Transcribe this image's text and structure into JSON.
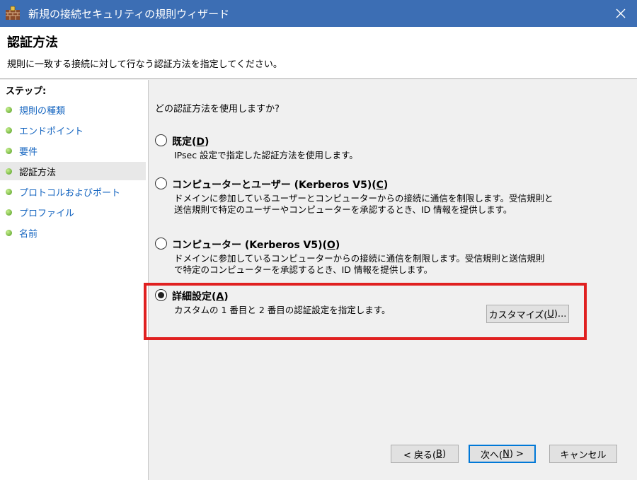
{
  "window": {
    "title": "新規の接続セキュリティの規則ウィザード",
    "close_glyph": "✕"
  },
  "header": {
    "title": "認証方法",
    "description": "規則に一致する接続に対して行なう認証方法を指定してください。"
  },
  "steps": {
    "title": "ステップ:",
    "items": [
      {
        "label": "規則の種類",
        "active": false
      },
      {
        "label": "エンドポイント",
        "active": false
      },
      {
        "label": "要件",
        "active": false
      },
      {
        "label": "認証方法",
        "active": true
      },
      {
        "label": "プロトコルおよびポート",
        "active": false
      },
      {
        "label": "プロファイル",
        "active": false
      },
      {
        "label": "名前",
        "active": false
      }
    ]
  },
  "main": {
    "question": "どの認証方法を使用しますか?",
    "options": [
      {
        "label_pre": "既定(",
        "label_key": "D",
        "label_post": ")",
        "desc": [
          "IPsec 設定で指定した認証方法を使用します。"
        ],
        "checked": false
      },
      {
        "label_pre": "コンピューターとユーザー (Kerberos V5)(",
        "label_key": "C",
        "label_post": ")",
        "desc": [
          "ドメインに参加しているユーザーとコンピューターからの接続に通信を制限します。受信規則と",
          "送信規則で特定のユーザーやコンピューターを承認するとき、ID 情報を提供します。"
        ],
        "checked": false
      },
      {
        "label_pre": "コンピューター (Kerberos V5)(",
        "label_key": "O",
        "label_post": ")",
        "desc": [
          "ドメインに参加しているコンピューターからの接続に通信を制限します。受信規則と送信規則",
          "で特定のコンピューターを承認するとき、ID 情報を提供します。"
        ],
        "checked": false
      },
      {
        "label_pre": "詳細設定(",
        "label_key": "A",
        "label_post": ")",
        "desc": [
          "カスタムの 1 番目と 2 番目の認証設定を指定します。"
        ],
        "checked": true
      }
    ],
    "customize_button": {
      "pre": "カスタマイズ(",
      "key": "U",
      "post": ")..."
    }
  },
  "footer": {
    "back": {
      "pre": "< 戻る(",
      "key": "B",
      "post": ")"
    },
    "next": {
      "pre": "次へ(",
      "key": "N",
      "post": ") >"
    },
    "cancel": "キャンセル"
  },
  "colors": {
    "titlebar": "#3c6eb4",
    "highlight": "#e02020",
    "link": "#1565c0"
  }
}
